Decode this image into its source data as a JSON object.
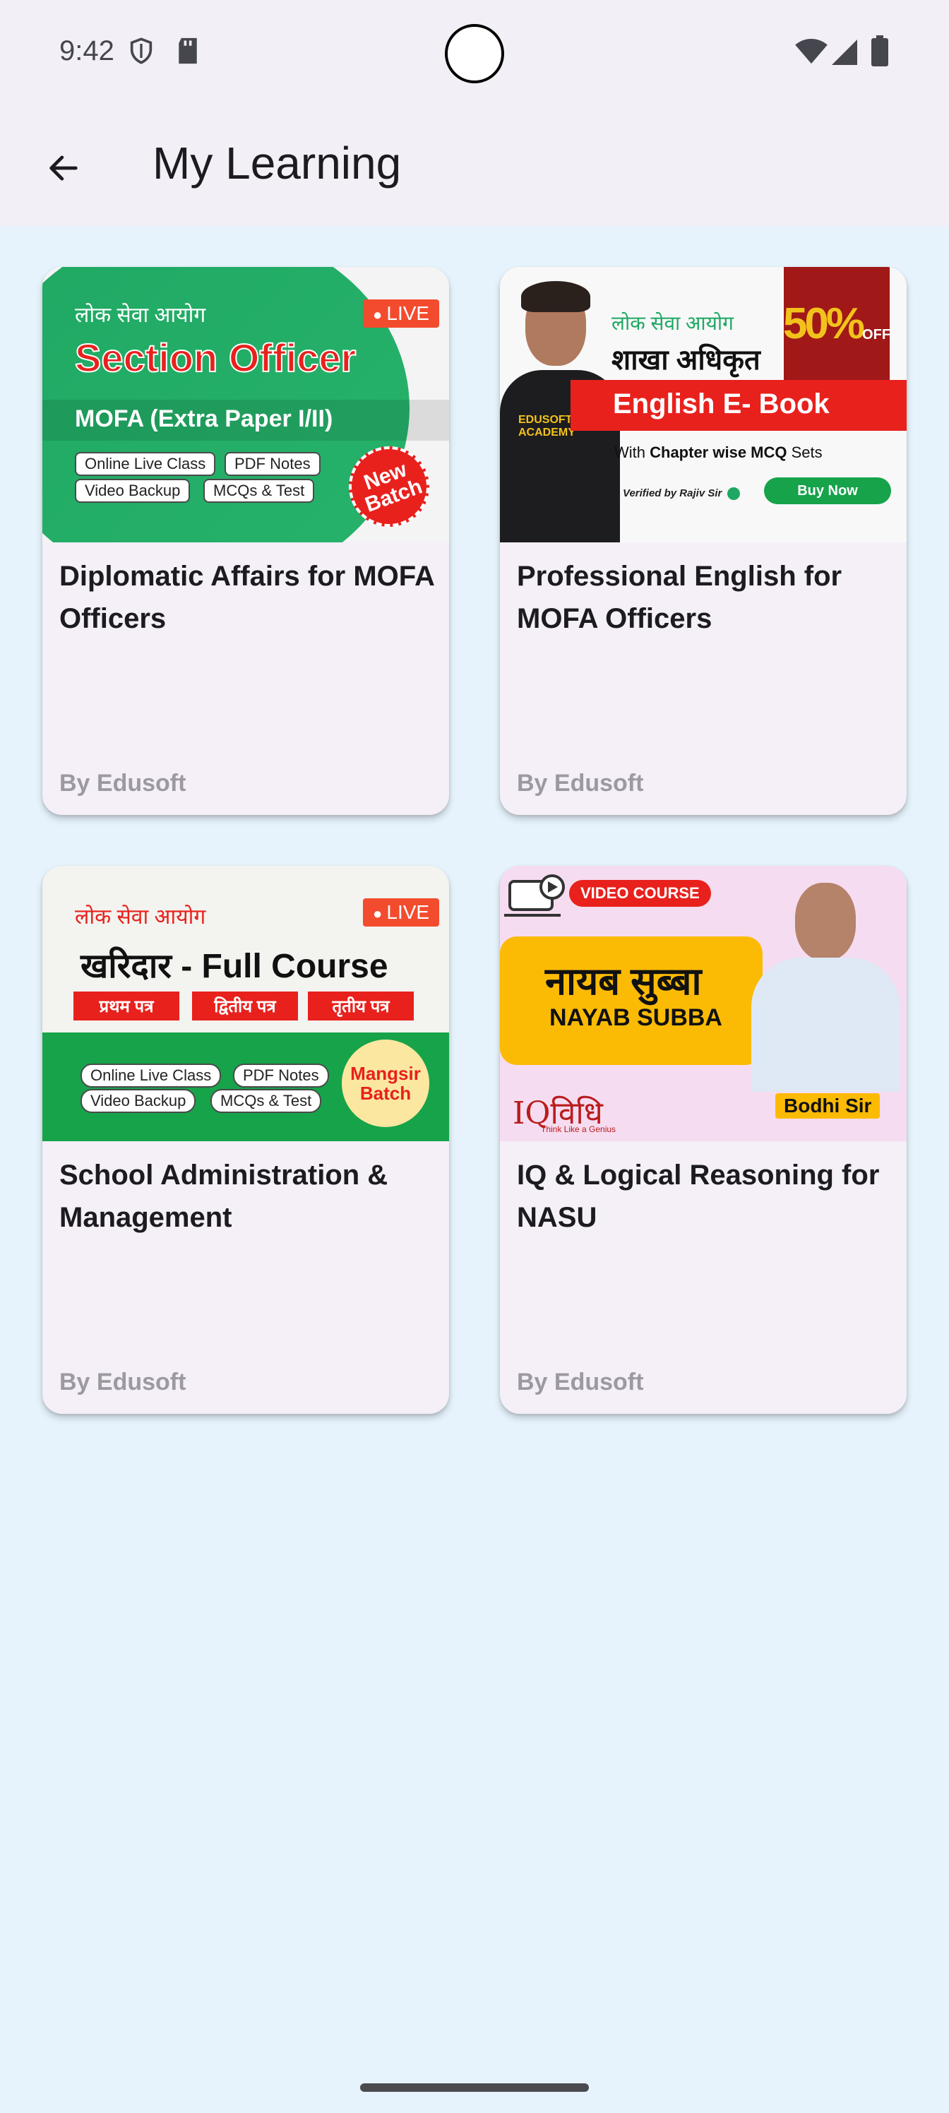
{
  "status_bar": {
    "time": "9:42"
  },
  "app_bar": {
    "title": "My Learning"
  },
  "courses": [
    {
      "title": "Diplomatic Affairs for MOFA Officers",
      "author": "By Edusoft",
      "thumbnail": {
        "org": "लोक सेवा आयोग",
        "live": "LIVE",
        "heading": "Section Officer",
        "subheading": "MOFA (Extra Paper I/II)",
        "pills": [
          "Online Live Class",
          "PDF Notes",
          "Video Backup",
          "MCQs & Test"
        ],
        "badge": "New Batch"
      }
    },
    {
      "title": "Professional English for MOFA Officers",
      "author": "By Edusoft",
      "thumbnail": {
        "org": "लोक सेवा आयोग",
        "heading": "शाखा अधिकृत",
        "discount": "50%",
        "discount_off": "OFF",
        "banner": "English E- Book",
        "caption_bold": "Chapter wise MCQ",
        "caption": "With Chapter wise MCQ Sets",
        "caption_prefix": "With",
        "caption_suffix": "Sets",
        "verified": "Verified by Rajiv Sir",
        "cta": "Buy Now",
        "shirt": "EDUSOFT ACADEMY"
      }
    },
    {
      "title": "School Administration & Management",
      "author": "By Edusoft",
      "thumbnail": {
        "org": "लोक सेवा आयोग",
        "live": "LIVE",
        "heading": "खरिदार - Full Course",
        "tags": [
          "प्रथम पत्र",
          "द्वितीय पत्र",
          "तृतीय पत्र"
        ],
        "pills": [
          "Online Live Class",
          "PDF Notes",
          "Video Backup",
          "MCQs & Test"
        ],
        "badge": "Mangsir Batch"
      }
    },
    {
      "title": "IQ & Logical Reasoning for NASU",
      "author": "By Edusoft",
      "thumbnail": {
        "tag": "VIDEO COURSE",
        "heading": "नायब सुब्बा",
        "subheading": "NAYAB SUBBA",
        "logo": "IQविधि",
        "logo_tagline": "Think Like a Genius",
        "teacher": "Bodhi Sir"
      }
    }
  ],
  "colors": {
    "background": "#e6f3fc",
    "bar": "#f3eff6",
    "card": "#f5eff7",
    "author": "#9c9aa0"
  }
}
